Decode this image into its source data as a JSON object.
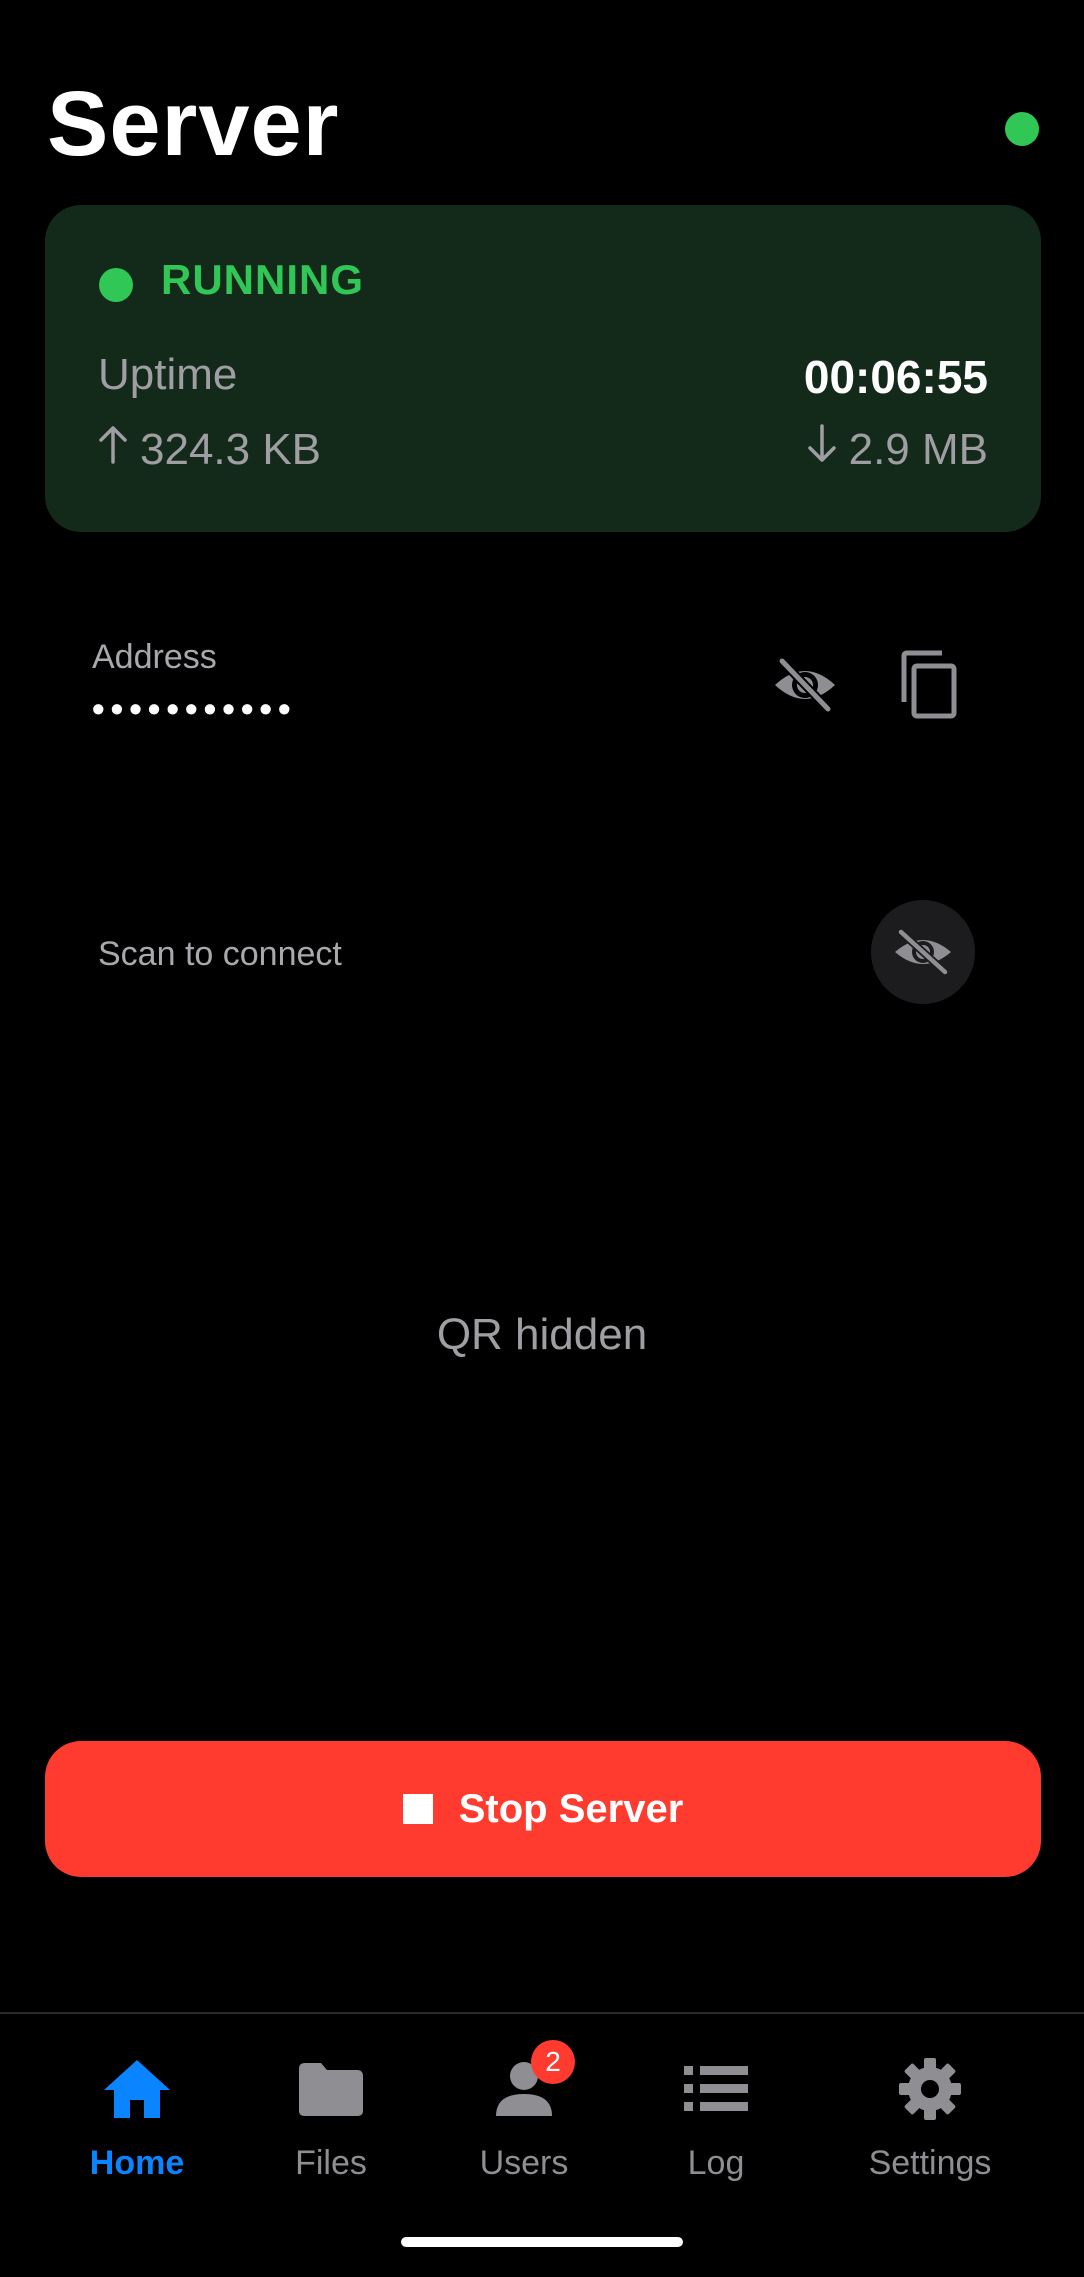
{
  "header": {
    "title": "Server",
    "status_color": "#30C757"
  },
  "status_card": {
    "state": "RUNNING",
    "uptime_label": "Uptime",
    "uptime_value": "00:06:55",
    "uploaded": "324.3 KB",
    "downloaded": "2.9 MB",
    "accent": "#30C757"
  },
  "address": {
    "label": "Address",
    "masked_value": "•••••••••••",
    "icons": [
      "eye-slash-icon",
      "copy-icon"
    ]
  },
  "qr": {
    "label": "Scan to connect",
    "hidden_text": "QR hidden",
    "icon": "eye-slash-icon"
  },
  "stop_button": {
    "label": "Stop Server",
    "color": "#FF3B30"
  },
  "tabs": [
    {
      "label": "Home",
      "icon": "home-icon",
      "active": true
    },
    {
      "label": "Files",
      "icon": "folder-icon"
    },
    {
      "label": "Users",
      "icon": "person-icon",
      "badge": "2"
    },
    {
      "label": "Log",
      "icon": "list-icon"
    },
    {
      "label": "Settings",
      "icon": "gear-icon"
    }
  ]
}
